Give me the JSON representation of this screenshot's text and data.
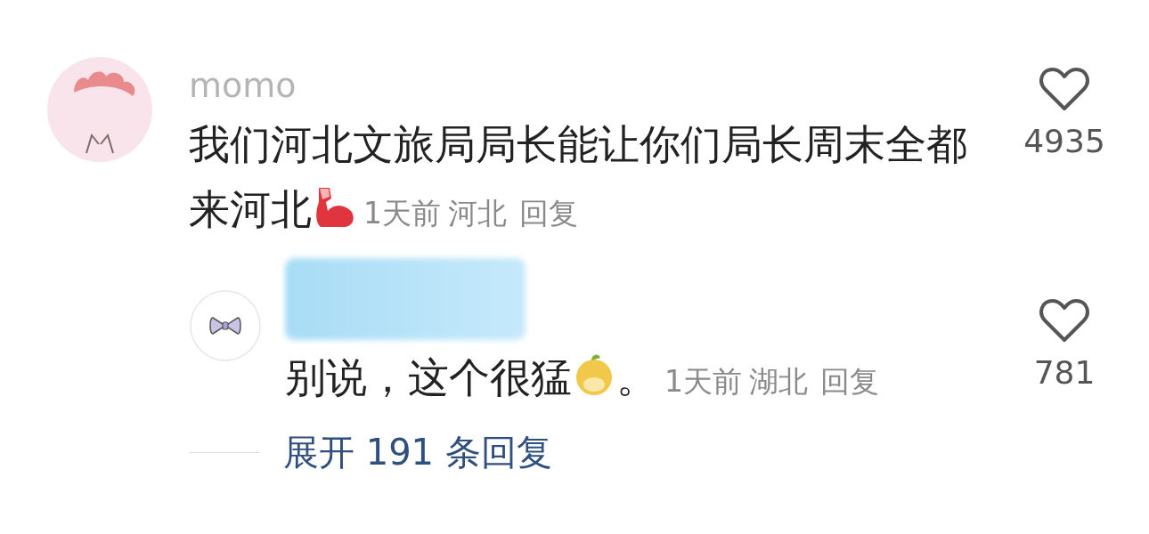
{
  "comment": {
    "kind": "comment",
    "username": "momo",
    "lines": [
      "我们河北文旅局局长能让你们局长周末全都",
      "来河北"
    ],
    "time": "1天前",
    "location": "河北",
    "reply_label": "回复",
    "liked": false,
    "likes": "4935",
    "replies": [
      {
        "kind": "reply",
        "redacted": true,
        "lines": [
          "别说，这个很猛"
        ],
        "tail": "。",
        "time": "1天前",
        "location": "湖北",
        "reply_label": "回复",
        "liked": false,
        "likes": "781"
      }
    ],
    "expand_label": "展开 191 条回复"
  }
}
